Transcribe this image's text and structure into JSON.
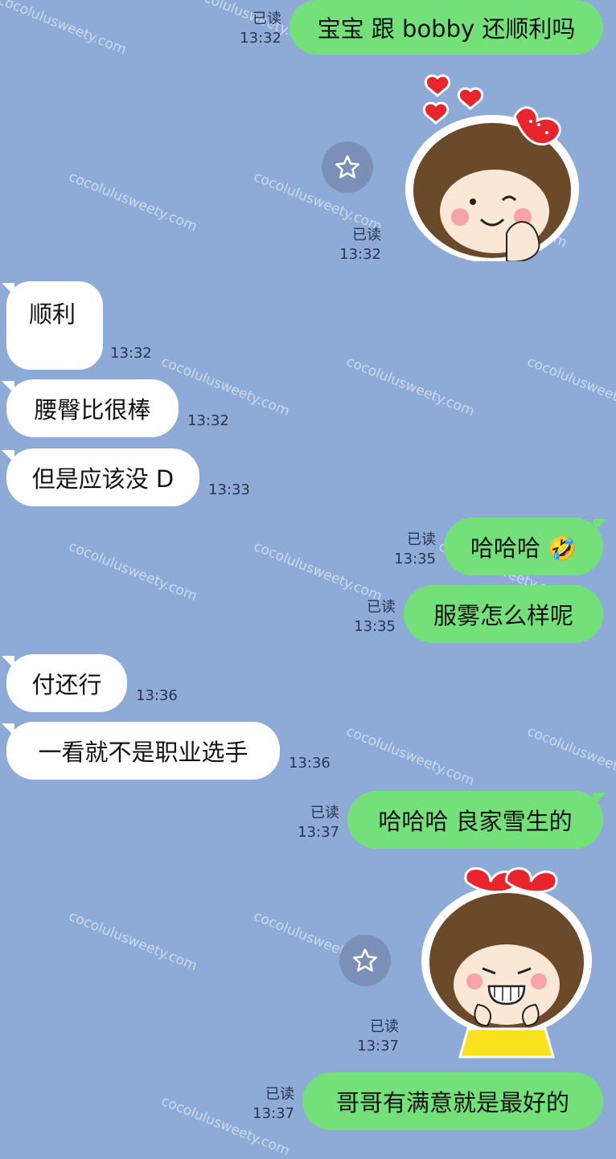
{
  "watermark": "cocolulusweety.com",
  "colors": {
    "background": "#8eabd8",
    "incoming_bubble": "#ffffff",
    "outgoing_bubble": "#74e07a"
  },
  "messages": {
    "m1": {
      "text": "宝宝 跟 bobby 还顺利吗",
      "read": "已读",
      "time": "13:32"
    },
    "m2": {
      "sticker": "girl-with-hearts-sticker",
      "read": "已读",
      "time": "13:32"
    },
    "m3": {
      "text": "顺利",
      "time": "13:32"
    },
    "m4": {
      "text": "腰臀比很棒",
      "time": "13:32"
    },
    "m5": {
      "text": "但是应该没 D",
      "time": "13:33"
    },
    "m6": {
      "text": "哈哈哈 🤣",
      "read": "已读",
      "time": "13:35"
    },
    "m7": {
      "text": "服雾怎么样呢",
      "read": "已读",
      "time": "13:35"
    },
    "m8": {
      "text": "付还行",
      "time": "13:36"
    },
    "m9": {
      "text": "一看就不是职业选手",
      "time": "13:36"
    },
    "m10": {
      "text": "哈哈哈 良家雪生的",
      "read": "已读",
      "time": "13:37"
    },
    "m11": {
      "sticker": "grinning-girl-sticker",
      "read": "已读",
      "time": "13:37"
    },
    "m12": {
      "text": "哥哥有满意就是最好的",
      "read": "已读",
      "time": "13:37"
    }
  }
}
